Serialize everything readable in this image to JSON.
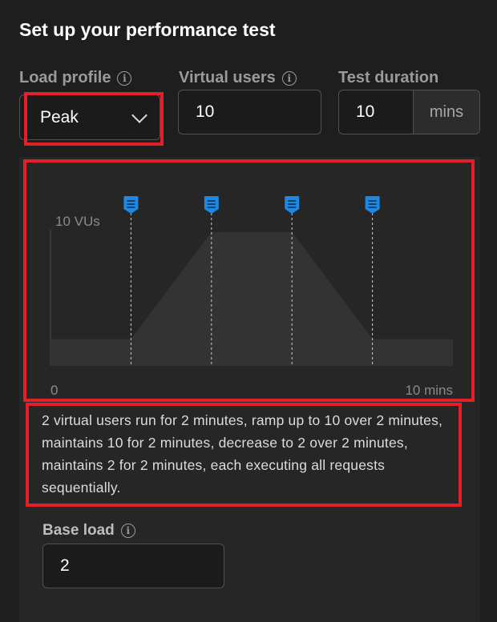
{
  "title": "Set up your performance test",
  "load_profile": {
    "label": "Load profile",
    "selected": "Peak"
  },
  "virtual_users": {
    "label": "Virtual users",
    "value": "10"
  },
  "test_duration": {
    "label": "Test duration",
    "value": "10",
    "unit": "mins"
  },
  "chart_data": {
    "type": "area",
    "x": [
      0,
      2,
      4,
      6,
      8,
      10
    ],
    "values": [
      2,
      2,
      10,
      10,
      2,
      2
    ],
    "y_max_label": "10 VUs",
    "x_start_label": "0",
    "x_end_label": "10 mins",
    "ylim": [
      0,
      10
    ],
    "xlim": [
      0,
      10
    ],
    "markers_at": [
      2,
      4,
      6,
      8
    ],
    "area_color": "#333333",
    "marker_color": "#1e88e5"
  },
  "description": "2 virtual users run for 2 minutes, ramp up to 10 over 2 minutes, maintains 10 for 2 minutes, decrease to 2 over 2 minutes, maintains 2 for 2 minutes, each executing all requests sequentially.",
  "base_load": {
    "label": "Base load",
    "value": "2"
  },
  "icons": {
    "info": "info-icon",
    "chevron": "chevron-down-icon",
    "marker": "stage-marker-icon"
  },
  "colors": {
    "highlight": "#e3202a",
    "accent": "#1e88e5"
  }
}
